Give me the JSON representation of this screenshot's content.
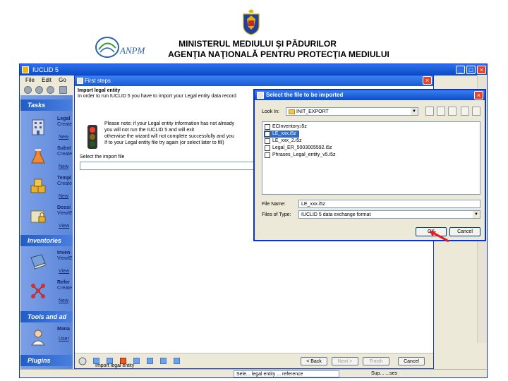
{
  "header": {
    "line1": "MINISTERUL MEDIULUI ŞI PĂDURILOR",
    "line2": "AGENŢIA NAŢIONALĂ PENTRU PROTECŢIA MEDIULUI",
    "anpm_logo_text": "ANPM"
  },
  "app": {
    "title": "IUCLID 5",
    "menu": [
      "File",
      "Edit",
      "Go"
    ],
    "sections": {
      "tasks": "Tasks",
      "inventories": "Inventories",
      "tools": "Tools and ad",
      "plugins": "Plugins"
    },
    "task_items": [
      {
        "title": "Legal",
        "desc": "Create",
        "link": "New"
      },
      {
        "title": "Subst",
        "desc": "Create",
        "link": "New"
      },
      {
        "title": "Templ",
        "desc": "Create",
        "link": "New"
      },
      {
        "title": "Dossi",
        "desc": "View/E",
        "link": "View"
      },
      {
        "title": "Inven",
        "desc": "View/E",
        "link": "View"
      },
      {
        "title": "Refer",
        "desc": "Create",
        "link": "New"
      },
      {
        "title": "Mana",
        "desc": "",
        "link": "User"
      }
    ],
    "status_combo": "Sele... legal entity ... reference",
    "status_right": "Sup... ...ses"
  },
  "first_steps": {
    "title": "First steps",
    "heading": "Import legal entity",
    "instruction": "In order to run IUCLID 5 you have to import your Legal entity data record",
    "note_lines": [
      "Please note: if your Legal entity information has not already",
      "you will not run the IUCLID 5 and will exit",
      "otherwise the wizard will not complete successfully and you",
      "If to your Legal entity file try again (or select later to fill)"
    ],
    "select_label": "Select the import file",
    "step_label": "Import legal entity",
    "buttons": {
      "back": "< Back",
      "next": "Next >",
      "finish": "Finish",
      "cancel": "Cancel"
    }
  },
  "dialog": {
    "title": "Select the file to be imported",
    "look_in_label": "Look In:",
    "look_in_value": "INIT_EXPORT",
    "files": [
      "ECInventory.i5z",
      "LE_xxx.i5z",
      "LE_xxx_2.i5z",
      "Legal_ER_5003005592.i5z",
      "Phrases_Legal_entity_v5.i5z"
    ],
    "selected_index": 1,
    "file_name_label": "File Name:",
    "file_name_value": "LE_xxx.i5z",
    "file_type_label": "Files of Type:",
    "file_type_value": "IUCLID 5 data exchange format",
    "ok": "OK",
    "cancel": "Cancel"
  },
  "colors": {
    "xp_title_blue": "#0a49c7",
    "sidebar_blue": "#5c86d9",
    "selection_blue": "#316ac5",
    "annotation_red": "#e02020"
  }
}
